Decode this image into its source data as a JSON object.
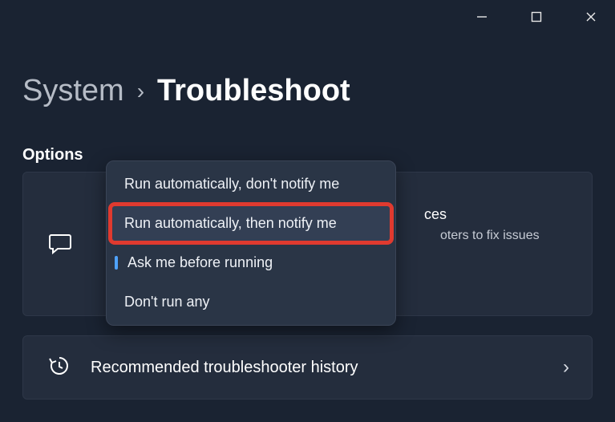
{
  "window_controls": {
    "min": "minimize",
    "max": "maximize",
    "close": "close"
  },
  "breadcrumb": {
    "parent": "System",
    "current": "Troubleshoot"
  },
  "section_label": "Options",
  "pref_card": {
    "title_fragment": "ces",
    "subtitle_fragment": "oters to fix issues"
  },
  "dropdown": {
    "items": [
      {
        "label": "Run automatically, don't notify me"
      },
      {
        "label": "Run automatically, then notify me"
      },
      {
        "label": "Ask me before running"
      },
      {
        "label": "Don't run any"
      }
    ],
    "selected_index": 2,
    "highlighted_index": 1
  },
  "history_row": {
    "label": "Recommended troubleshooter history"
  }
}
